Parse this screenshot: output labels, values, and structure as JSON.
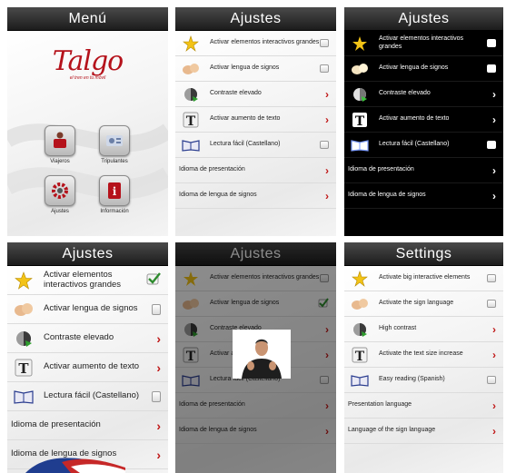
{
  "menu": {
    "title": "Menú",
    "logo_text": "Talgo",
    "logo_tagline": "el tren en tu móvil",
    "buttons": [
      {
        "label": "Viajeros",
        "icon": "travelers-icon"
      },
      {
        "label": "Tripulantes",
        "icon": "crew-icon"
      },
      {
        "label": "Ajustes",
        "icon": "settings-gear-icon"
      },
      {
        "label": "Información",
        "icon": "information-icon"
      }
    ]
  },
  "ajustes": {
    "title": "Ajustes",
    "items": [
      {
        "label": "Activar elementos interactivos grandes",
        "control": "checkbox",
        "icon": "star-icon"
      },
      {
        "label": "Activar lengua de signos",
        "control": "checkbox",
        "icon": "sign-language-hands-icon"
      },
      {
        "label": "Contraste elevado",
        "control": "chevron",
        "icon": "contrast-globe-icon"
      },
      {
        "label": "Activar aumento de texto",
        "control": "chevron",
        "icon": "text-size-icon"
      },
      {
        "label": "Lectura fácil (Castellano)",
        "control": "checkbox",
        "icon": "open-book-icon"
      },
      {
        "label": "Idioma de presentación",
        "control": "chevron"
      },
      {
        "label": "Idioma de lengua de signos",
        "control": "chevron"
      }
    ]
  },
  "settings": {
    "title": "Settings",
    "items": [
      {
        "label": "Activate big interactive elements",
        "control": "checkbox",
        "icon": "star-icon"
      },
      {
        "label": "Activate the sign language",
        "control": "checkbox",
        "icon": "sign-language-hands-icon"
      },
      {
        "label": "High contrast",
        "control": "chevron",
        "icon": "contrast-globe-icon"
      },
      {
        "label": "Activate the text size increase",
        "control": "chevron",
        "icon": "text-size-icon"
      },
      {
        "label": "Easy reading (Spanish)",
        "control": "checkbox",
        "icon": "open-book-icon"
      },
      {
        "label": "Presentation language",
        "control": "chevron"
      },
      {
        "label": "Language of the sign language",
        "control": "chevron"
      }
    ]
  },
  "states": {
    "big_elements_checked_panel": "large",
    "sign_language_checked_panel": "video"
  },
  "colors": {
    "accent_red": "#c01818",
    "logo_red": "#b5121b",
    "check_green": "#2e8b2e"
  }
}
